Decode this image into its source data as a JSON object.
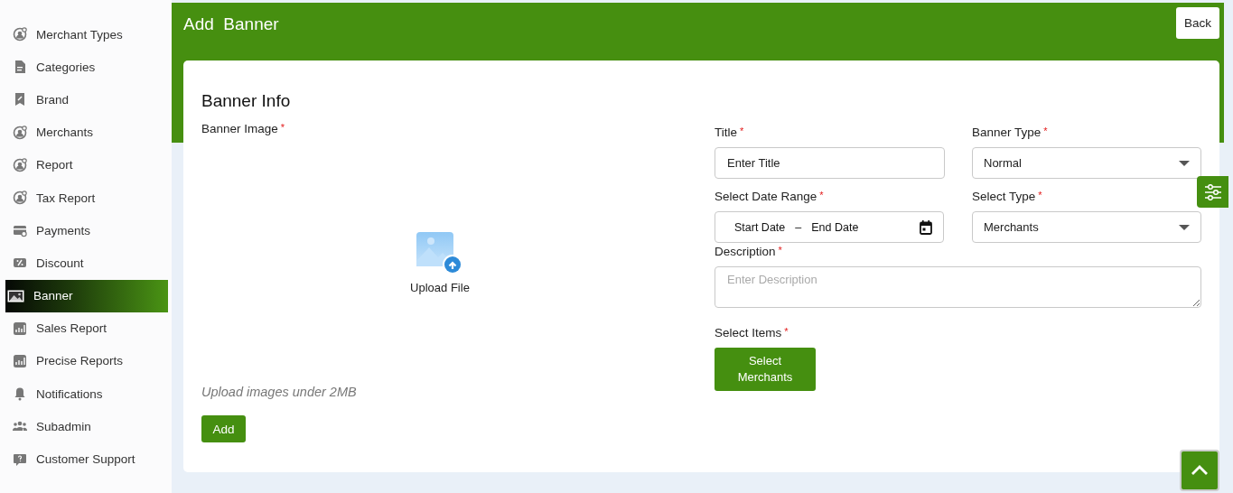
{
  "sidebar": {
    "items": [
      {
        "label": "Merchant Types",
        "selected": false
      },
      {
        "label": "Categories",
        "selected": false
      },
      {
        "label": "Brand",
        "selected": false
      },
      {
        "label": "Merchants",
        "selected": false
      },
      {
        "label": "Report",
        "selected": false
      },
      {
        "label": "Tax Report",
        "selected": false
      },
      {
        "label": "Payments",
        "selected": false
      },
      {
        "label": "Discount",
        "selected": false
      },
      {
        "label": "Banner",
        "selected": true
      },
      {
        "label": "Sales Report",
        "selected": false
      },
      {
        "label": "Precise Reports",
        "selected": false
      },
      {
        "label": "Notifications",
        "selected": false
      },
      {
        "label": "Subadmin",
        "selected": false
      },
      {
        "label": "Customer Support",
        "selected": false
      }
    ]
  },
  "header": {
    "title": "Add  Banner",
    "back_button": "Back"
  },
  "form": {
    "heading": "Banner Info",
    "image": {
      "label": "Banner Image",
      "required_mark": "*",
      "upload_text": "Upload File",
      "hint": "Upload images under 2MB"
    },
    "fields": [
      {
        "kind": "text",
        "label": "Title",
        "required_mark": "*",
        "placeholder": "Enter Title"
      },
      {
        "kind": "select",
        "label": "Banner Type",
        "required_mark": "*",
        "value": "Normal"
      },
      {
        "kind": "daterange",
        "label": "Select Date Range",
        "required_mark": "*",
        "start": "Start Date",
        "separator": "–",
        "end": "End Date"
      },
      {
        "kind": "select",
        "label": "Select Type",
        "required_mark": "*",
        "value": "Merchants"
      },
      {
        "kind": "textarea",
        "label": "Description",
        "required_mark": "*",
        "placeholder": "Enter Description"
      },
      {
        "kind": "button",
        "label": "Select Items",
        "required_mark": "*",
        "button": "Select Merchants"
      }
    ],
    "add_button": "Add"
  }
}
